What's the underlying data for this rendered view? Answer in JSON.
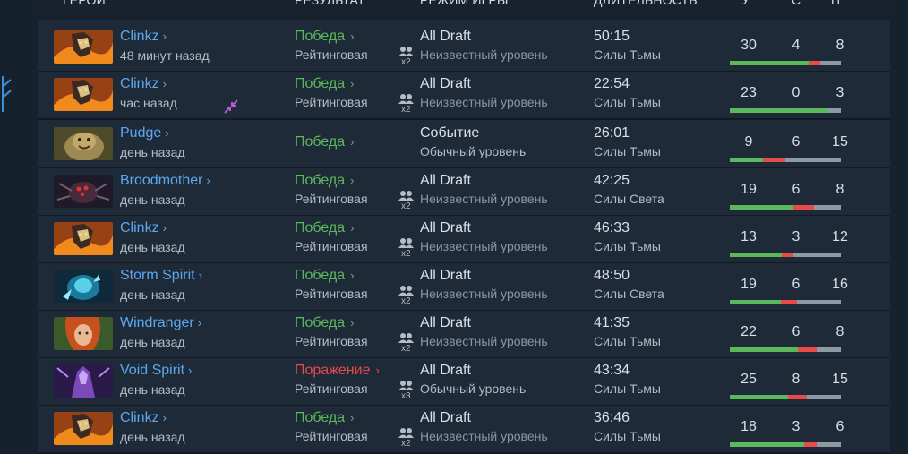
{
  "header": {
    "hero": "ГЕРОЙ",
    "result": "РЕЗУЛЬТАТ",
    "mode": "РЕЖИМ ИГРЫ",
    "duration": "ДЛИТЕЛЬНОСТЬ",
    "k": "У",
    "d": "С",
    "a": "П"
  },
  "matches": [
    {
      "hero": "Clinkz",
      "time": "48 минут назад",
      "result": "Победа",
      "outcome": "win",
      "lobby": "Рейтинговая",
      "party": "x2",
      "mode": "All Draft",
      "skill": "Неизвестный уровень",
      "duration": "50:15",
      "side": "Силы Тьмы",
      "k": "30",
      "d": "4",
      "a": "8",
      "portrait": "clinkz"
    },
    {
      "hero": "Clinkz",
      "time": "час назад",
      "result": "Победа",
      "outcome": "win",
      "lobby": "Рейтинговая",
      "party": "x2",
      "mode": "All Draft",
      "skill": "Неизвестный уровень",
      "duration": "22:54",
      "side": "Силы Тьмы",
      "k": "23",
      "d": "0",
      "a": "3",
      "portrait": "clinkz"
    },
    {
      "hero": "Pudge",
      "time": "день назад",
      "result": "Победа",
      "outcome": "win",
      "lobby": "",
      "party": "",
      "mode": "Событие",
      "skill": "Обычный уровень",
      "duration": "26:01",
      "side": "Силы Тьмы",
      "k": "9",
      "d": "6",
      "a": "15",
      "portrait": "pudge"
    },
    {
      "hero": "Broodmother",
      "time": "день назад",
      "result": "Победа",
      "outcome": "win",
      "lobby": "Рейтинговая",
      "party": "x2",
      "mode": "All Draft",
      "skill": "Неизвестный уровень",
      "duration": "42:25",
      "side": "Силы Света",
      "k": "19",
      "d": "6",
      "a": "8",
      "portrait": "brood"
    },
    {
      "hero": "Clinkz",
      "time": "день назад",
      "result": "Победа",
      "outcome": "win",
      "lobby": "Рейтинговая",
      "party": "x2",
      "mode": "All Draft",
      "skill": "Неизвестный уровень",
      "duration": "46:33",
      "side": "Силы Тьмы",
      "k": "13",
      "d": "3",
      "a": "12",
      "portrait": "clinkz"
    },
    {
      "hero": "Storm Spirit",
      "time": "день назад",
      "result": "Победа",
      "outcome": "win",
      "lobby": "Рейтинговая",
      "party": "x2",
      "mode": "All Draft",
      "skill": "Неизвестный уровень",
      "duration": "48:50",
      "side": "Силы Света",
      "k": "19",
      "d": "6",
      "a": "16",
      "portrait": "storm"
    },
    {
      "hero": "Windranger",
      "time": "день назад",
      "result": "Победа",
      "outcome": "win",
      "lobby": "Рейтинговая",
      "party": "x2",
      "mode": "All Draft",
      "skill": "Неизвестный уровень",
      "duration": "41:35",
      "side": "Силы Тьмы",
      "k": "22",
      "d": "6",
      "a": "8",
      "portrait": "wind"
    },
    {
      "hero": "Void Spirit",
      "time": "день назад",
      "result": "Поражение",
      "outcome": "loss",
      "lobby": "Рейтинговая",
      "party": "x3",
      "mode": "All Draft",
      "skill": "Обычный уровень",
      "duration": "43:34",
      "side": "Силы Тьмы",
      "k": "25",
      "d": "8",
      "a": "15",
      "portrait": "void"
    },
    {
      "hero": "Clinkz",
      "time": "день назад",
      "result": "Победа",
      "outcome": "win",
      "lobby": "Рейтинговая",
      "party": "x2",
      "mode": "All Draft",
      "skill": "Неизвестный уровень",
      "duration": "36:46",
      "side": "Силы Тьмы",
      "k": "18",
      "d": "3",
      "a": "6",
      "portrait": "clinkz"
    }
  ],
  "colors": {
    "win": "#5cb85c",
    "loss": "#e84a4a",
    "hero_link": "#5ba8f0",
    "assist_bar": "#8d99a4"
  },
  "icons": [
    "chevron-right-icon",
    "party-icon",
    "shrink-arrows-icon",
    "tree-edge-icon"
  ]
}
